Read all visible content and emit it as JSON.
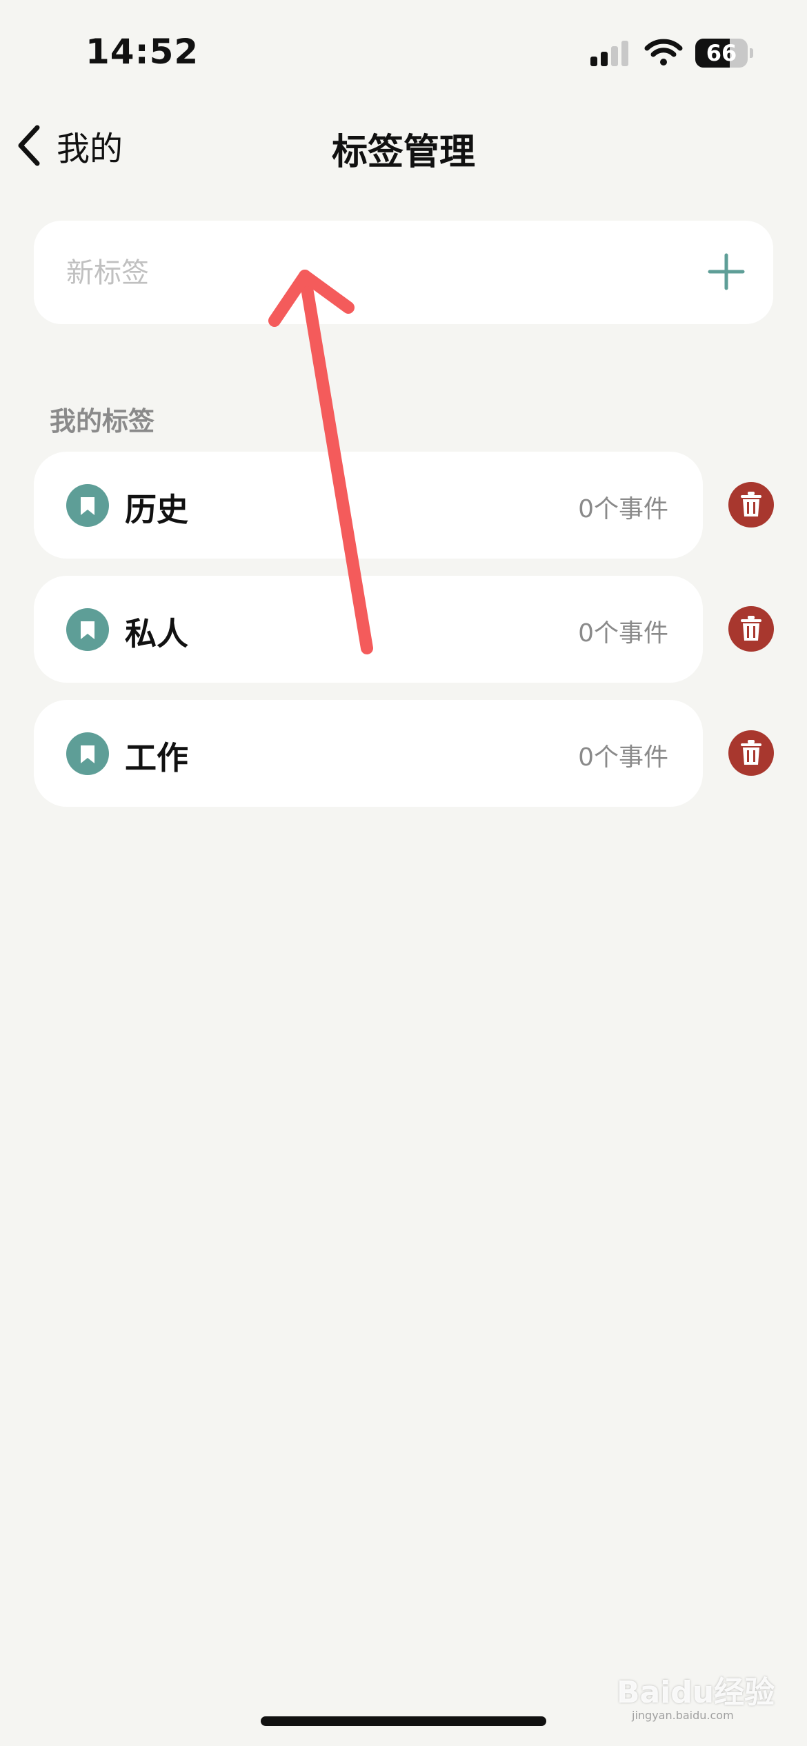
{
  "status_bar": {
    "time": "14:52",
    "battery_level": 66,
    "battery_text": "66"
  },
  "nav": {
    "back_label": "我的",
    "title": "标签管理"
  },
  "new_tag": {
    "placeholder": "新标签"
  },
  "section": {
    "title": "我的标签"
  },
  "tags": [
    {
      "name": "历史",
      "count": "0个事件"
    },
    {
      "name": "私人",
      "count": "0个事件"
    },
    {
      "name": "工作",
      "count": "0个事件"
    }
  ],
  "icons": {
    "back": "chevron-left-icon",
    "add": "plus-icon",
    "tag": "bookmark-icon",
    "delete": "trash-icon"
  },
  "colors": {
    "background": "#f5f5f2",
    "accent": "#5e9e97",
    "delete": "#a8372e",
    "annotation": "#f45b5b"
  },
  "watermark": {
    "logo_text": "Baidu经验",
    "url": "jingyan.baidu.com"
  }
}
